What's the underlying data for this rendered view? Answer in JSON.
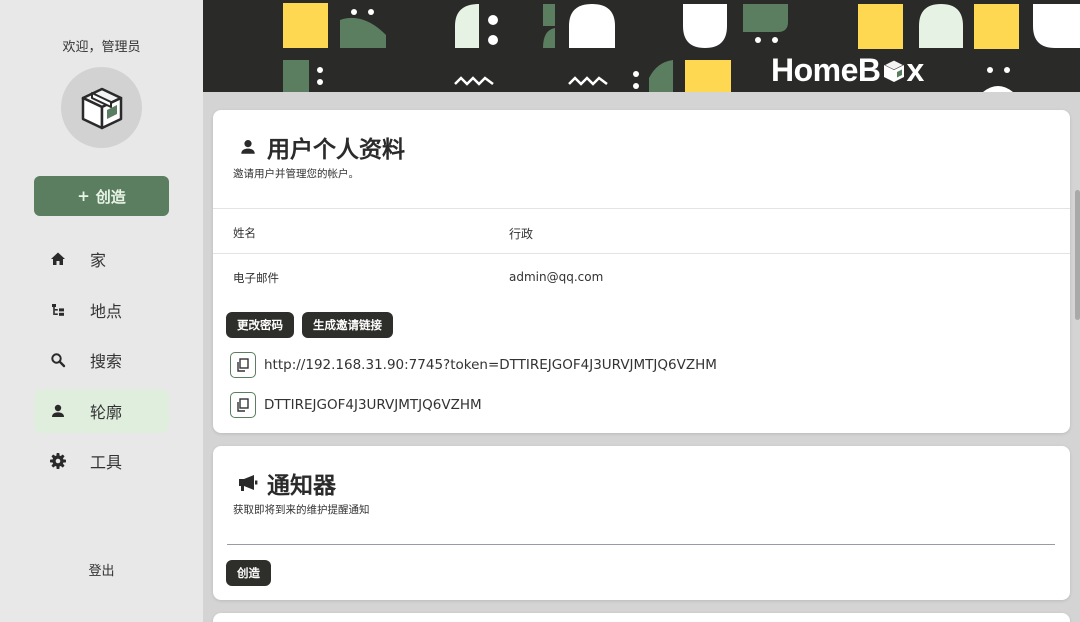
{
  "sidebar": {
    "welcome": "欢迎，管理员",
    "create_label": "创造",
    "items": [
      {
        "label": "家",
        "icon": "home-icon"
      },
      {
        "label": "地点",
        "icon": "tree-icon"
      },
      {
        "label": "搜索",
        "icon": "search-icon"
      },
      {
        "label": "轮廓",
        "icon": "person-icon"
      },
      {
        "label": "工具",
        "icon": "gear-icon"
      }
    ],
    "active_index": 3,
    "logout": "登出"
  },
  "banner": {
    "brand_left": "HomeB",
    "brand_right": "x"
  },
  "profile": {
    "title": "用户个人资料",
    "subtitle": "邀请用户并管理您的帐户。",
    "name_label": "姓名",
    "name_value": "行政",
    "email_label": "电子邮件",
    "email_value": "admin@qq.com",
    "change_password": "更改密码",
    "generate_invite": "生成邀请链接",
    "invite_url": "http://192.168.31.90:7745?token=DTTIREJGOF4J3URVJMTJQ6VZHM",
    "invite_token": "DTTIREJGOF4J3URVJMTJQ6VZHM"
  },
  "notifier": {
    "title": "通知器",
    "subtitle": "获取即将到来的维护提醒通知",
    "create": "创造"
  },
  "colors": {
    "accent": "#5b7d60",
    "banner_bg": "#2a2a28",
    "yellow": "#fed850",
    "mint": "#e6f2e4",
    "active_bg": "#dfeedd"
  }
}
